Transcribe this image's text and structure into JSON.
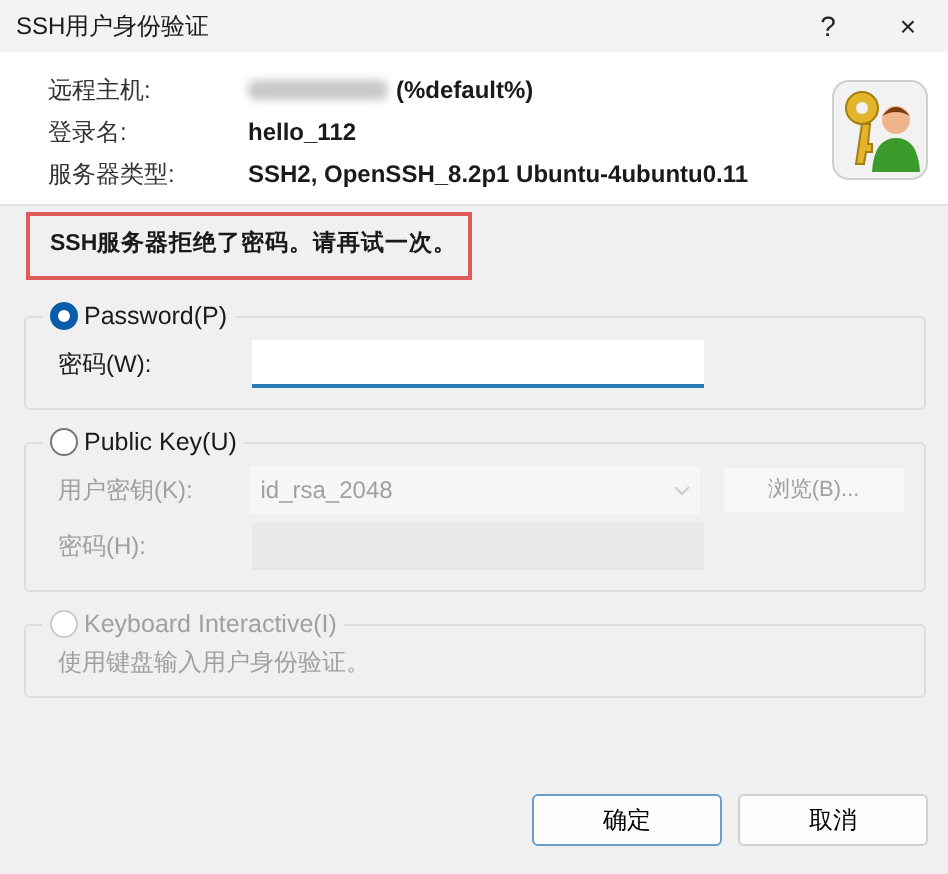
{
  "window": {
    "title": "SSH用户身份验证",
    "help": "?",
    "close": "×"
  },
  "info": [
    {
      "label": "远程主机:",
      "value": "(%default%)",
      "masked": true
    },
    {
      "label": "登录名:",
      "value": "hello_112",
      "masked": false
    },
    {
      "label": "服务器类型:",
      "value": "SSH2, OpenSSH_8.2p1 Ubuntu-4ubuntu0.11",
      "masked": false
    }
  ],
  "error": "SSH服务器拒绝了密码。请再试一次。",
  "auth_methods": [
    {
      "label": "Password(P)",
      "selected": true,
      "disabled": false,
      "fields": [
        {
          "kind": "text",
          "label": "密码(W):",
          "focused": true,
          "disabled": false
        }
      ]
    },
    {
      "label": "Public Key(U)",
      "selected": false,
      "disabled": false,
      "fields": [
        {
          "kind": "select",
          "label": "用户密钥(K):",
          "value": "id_rsa_2048",
          "disabled": true,
          "button": "浏览(B)..."
        },
        {
          "kind": "text",
          "label": "密码(H):",
          "focused": false,
          "disabled": true
        }
      ]
    },
    {
      "label": "Keyboard Interactive(I)",
      "selected": false,
      "disabled": true,
      "note": "使用键盘输入用户身份验证。"
    }
  ],
  "buttons": [
    {
      "label": "确定",
      "default": true
    },
    {
      "label": "取消",
      "default": false
    }
  ]
}
